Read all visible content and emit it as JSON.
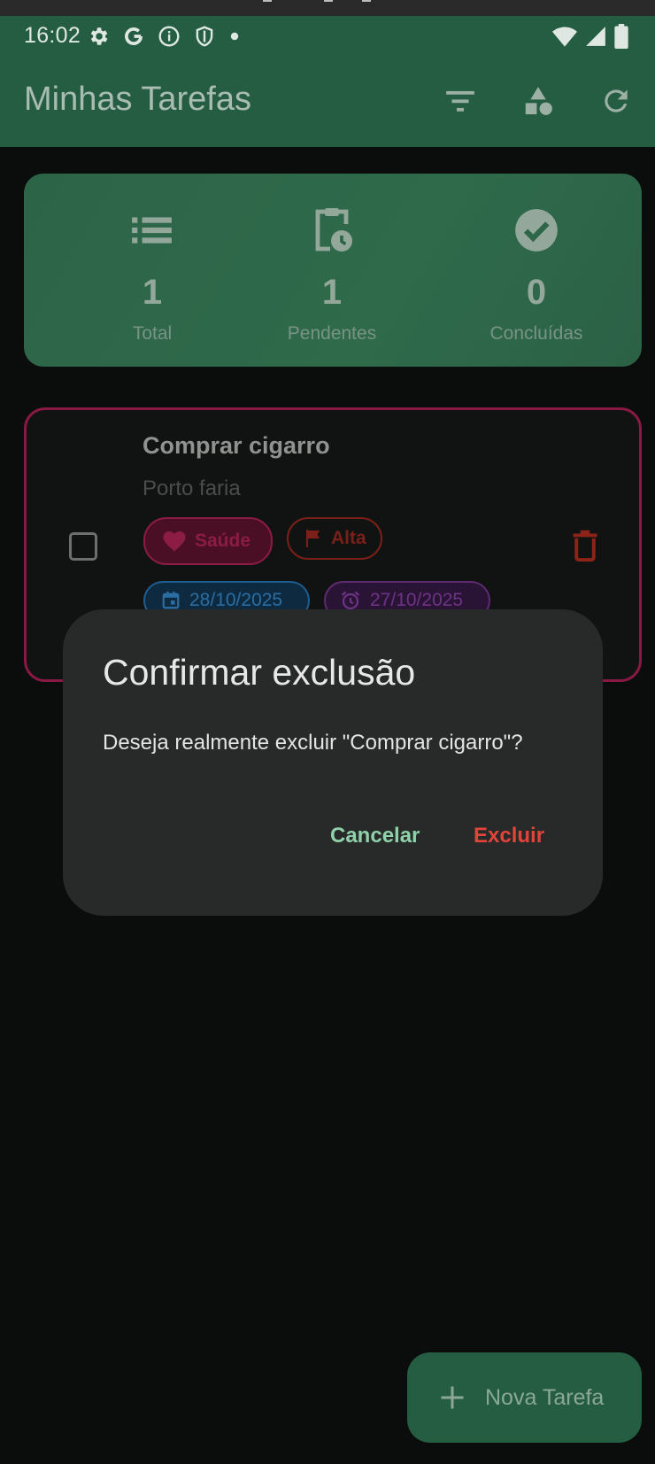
{
  "status_bar": {
    "time": "16:02",
    "left_icons": [
      "gear-icon",
      "google-icon",
      "info-icon",
      "shield-icon",
      "dot-icon"
    ],
    "right_icons": [
      "wifi-icon",
      "cell-signal-icon",
      "battery-icon"
    ]
  },
  "app_bar": {
    "title": "Minhas Tarefas",
    "actions": [
      "filter-icon",
      "category-shapes-icon",
      "refresh-icon"
    ]
  },
  "stats": [
    {
      "icon": "list-icon",
      "value": "1",
      "label": "Total"
    },
    {
      "icon": "clipboard-clock-icon",
      "value": "1",
      "label": "Pendentes"
    },
    {
      "icon": "check-circle-icon",
      "value": "0",
      "label": "Concluídas"
    }
  ],
  "task": {
    "title": "Comprar cigarro",
    "description": "Porto faria",
    "completed": false,
    "category": "Saúde",
    "priority": "Alta",
    "due_date": "28/10/2025",
    "reminder_date": "27/10/2025"
  },
  "dialog": {
    "title": "Confirmar exclusão",
    "message": "Deseja realmente excluir \"Comprar cigarro\"?",
    "cancel_label": "Cancelar",
    "confirm_label": "Excluir"
  },
  "fab": {
    "label": "Nova Tarefa",
    "icon": "plus-icon"
  },
  "colors": {
    "primary": "#255d42",
    "danger": "#e2443a",
    "accent_green": "#8fd1ab",
    "category_border": "#8c1c44"
  }
}
